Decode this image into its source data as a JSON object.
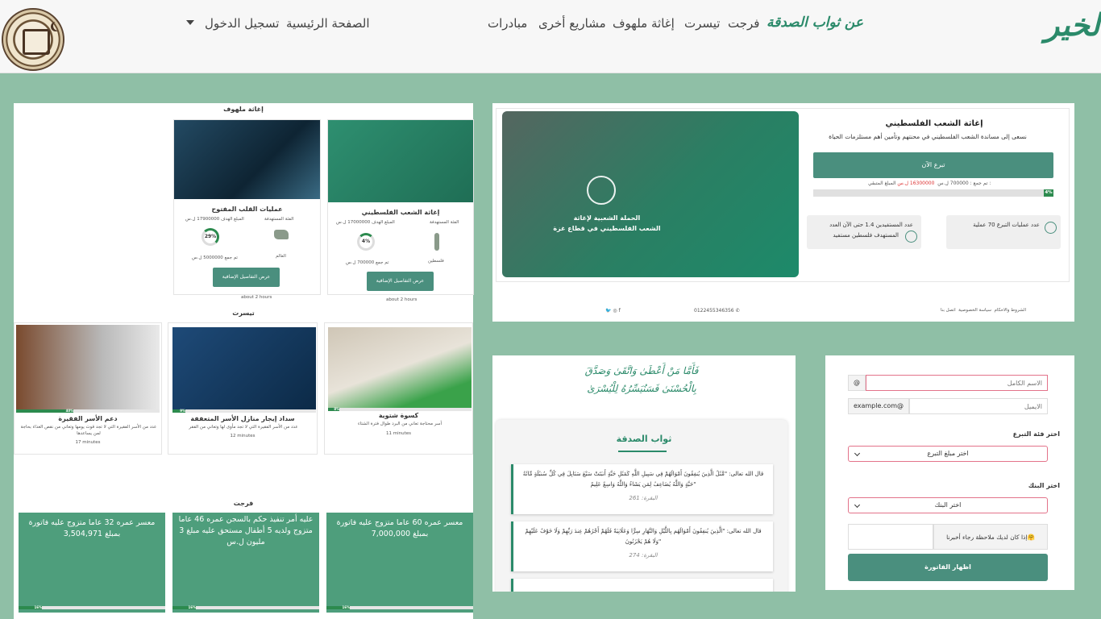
{
  "nav": {
    "brand": "الخير",
    "login": "تسجيل الدخول",
    "home": "الصفحة الرئيسية",
    "links": [
      "عن ثواب الصدقة",
      "فرجت",
      "تيسرت",
      "إغاثة ملهوف",
      "مشاريع أخرى",
      "مبادرات"
    ]
  },
  "relief": {
    "section_title": "إغاثة ملهوف",
    "cards": [
      {
        "title": "عمليات القلب المفتوح",
        "category_label": "الفئة المستهدفة",
        "target_label": "المبلغ الهدف 17900000 ل.س",
        "category": "العالم",
        "collected": "تم جمع 5000000 ل.س",
        "percent": 29,
        "button": "عرض التفاصيل الإضافية",
        "time": "about 2 hours"
      },
      {
        "title": "إغاثة الشعب الفلسطيني",
        "category_label": "الفئة المستهدفة",
        "target_label": "المبلغ الهدف 17000000 ل.س",
        "category": "فلسطين",
        "collected": "تم جمع 700000 ل.س",
        "percent": 4,
        "button": "عرض التفاصيل الإضافية",
        "time": "about 2 hours"
      }
    ]
  },
  "taysarat": {
    "section_title": "تيسرت",
    "cards": [
      {
        "title": "دعم الأسر الفقيرة",
        "desc": "عدد من الأسر الفقيرة التي لا تجد قوت يومها وتعاني من نقص الغذاء بحاجة لمن يساعدها",
        "percent": 40,
        "time": "17 minutes"
      },
      {
        "title": "سداد إيجار منازل الأسر المتعففة",
        "desc": "عدد من الأسر الفقيرة التي لا تجد مأوى لها وتعاني من الفقر",
        "percent": 9,
        "time": "12 minutes"
      },
      {
        "title": "كسوة شتوية",
        "desc": "أسر محتاجة تعاني من البرد طوال فترة الشتاء",
        "percent": 8,
        "time": "11 minutes"
      }
    ]
  },
  "farajat": {
    "section_title": "فرجت",
    "cards": [
      {
        "text": "معسر عمره 32 عاما متزوج عليه فاتورة بمبلغ 3,504,971",
        "percent": 16
      },
      {
        "text": "عليه أمر تنفيذ حكم بالسجن عمره 46 عاما متزوج ولديه 5 أطفال مستحق عليه مبلغ 3 مليون ل.س",
        "percent": 16
      },
      {
        "text": "معسر عمره 60 عاما متزوج عليه فاتورة بمبلغ 7,000,000",
        "percent": 16
      }
    ]
  },
  "campaign": {
    "banner_text_1": "الحملة الشعبية لإغاثة",
    "banner_text_2": "الشعب الفلسطيني في قطاع غزة",
    "title": "إغاثة الشعب الفلسطيني",
    "subtitle": "نسعى إلى مساندة الشعب الفلسطيني في محنتهم وتأمين أهم مستلزمات الحياة",
    "donate": "تبرع الآن",
    "remaining_label": "المبلغ المتبقي :",
    "remaining_value": "16300000 ل.س",
    "collected": "تم جمع : 700000 ل.س",
    "percent": 4,
    "stat_ops": "عدد عمليات التبرع 70 عملية",
    "stat_beneficiaries_1": "عدد المستفيدين 1.4 حتى الآن العدد",
    "stat_beneficiaries_2": "المستهدف فلسطين مستفيد",
    "footer_links": [
      "الشروط والاحكام",
      "سياسة الخصوصية",
      "اتصل بنا"
    ],
    "phone": "0122455346356"
  },
  "sadaqa": {
    "verse": "فَأَمَّا مَنْ أَعْطَىٰ وَاتَّقَىٰ وَصَدَّقَ بِالْحُسْنَىٰ فَسَنُيَسِّرُهُ لِلْيُسْرَىٰ",
    "title": "ثواب الصدقة",
    "quotes": [
      {
        "text": "قال الله تعالى: \"مَّثَلُ الَّذِينَ يُنفِقُونَ أَمْوَالَهُمْ فِي سَبِيلِ اللَّهِ كَمَثَلِ حَبَّةٍ أَنبَتَتْ سَبْعَ سَنَابِلَ فِي كُلِّ سُنبُلَةٍ مِّائَةُ حَبَّةٍ وَاللَّهُ يُضَاعِفُ لِمَن يَشَاءُ وَاللَّهُ وَاسِعٌ عَلِيمٌ\"",
        "ref": "البقرة: 261"
      },
      {
        "text": "قال الله تعالى: \"الَّذِينَ يُنفِقُونَ أَمْوَالَهُم بِاللَّيْلِ وَالنَّهَارِ سِرًّا وَعَلَانِيَةً فَلَهُمْ أَجْرُهُمْ عِندَ رَبِّهِمْ وَلَا خَوْفٌ عَلَيْهِمْ وَلَا هُمْ يَحْزَنُونَ\"",
        "ref": "البقرة: 274"
      }
    ]
  },
  "form": {
    "name_placeholder": "الاسم الكامل",
    "email_placeholder": "الايميل",
    "email_addon": "example.com@",
    "name_addon": "@",
    "category_label": "اختر فئة التبرع",
    "category_value": "اختر مبلغ التبرع",
    "bank_label": "اختر البنك",
    "bank_value": "اختر البنك",
    "note_label": "إذا كان لديك ملاحظة رجاء أخبرنا🤗",
    "submit": "اظهار الفاتورة"
  }
}
